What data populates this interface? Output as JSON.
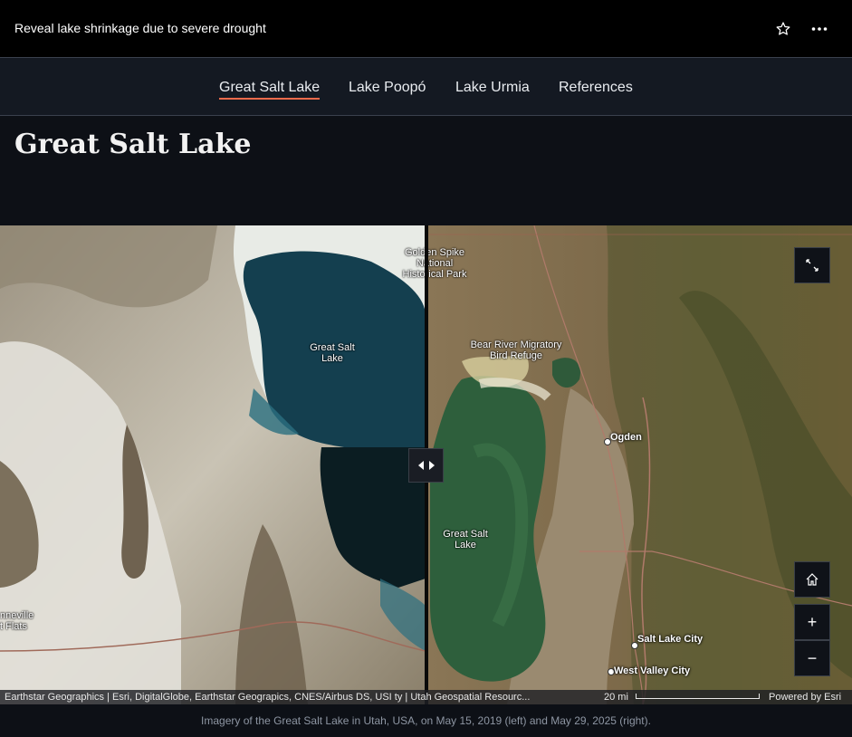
{
  "header": {
    "title": "Reveal lake shrinkage due to severe drought",
    "favorite_icon": "star-icon",
    "more_icon": "more-horizontal-icon"
  },
  "nav": {
    "tabs": [
      {
        "label": "Great Salt Lake",
        "active": true
      },
      {
        "label": "Lake Poopó",
        "active": false
      },
      {
        "label": "Lake Urmia",
        "active": false
      },
      {
        "label": "References",
        "active": false
      }
    ],
    "accent_color": "#f06a4b"
  },
  "section": {
    "title": "Great Salt Lake"
  },
  "map": {
    "left_labels": {
      "lake": "Great Salt\nLake",
      "edge": "nneville\nt Flats"
    },
    "right_labels": {
      "golden_spike": "Golden Spike\nNational\nHistorical Park",
      "bear_river": "Bear River Migratory\nBird Refuge",
      "lake": "Great Salt\nLake",
      "ogden": "Ogden",
      "slc": "Salt Lake City",
      "wvc": "West Valley City"
    },
    "controls": {
      "expand_icon": "expand-icon",
      "home_icon": "home-icon",
      "zoom_in": "+",
      "zoom_out": "−",
      "swipe_icon": "swipe-arrows-icon"
    },
    "attribution": "Earthstar Geographics | Esri, DigitalGlobe, Earthstar Geograpics, CNES/Airbus DS, USI ty | Utah Geospatial Resourc...",
    "scale": "20 mi",
    "powered_by": "Powered by Esri"
  },
  "caption": "Imagery of the Great Salt Lake in Utah, USA, on May 15, 2019 (left) and May 29, 2025 (right)."
}
